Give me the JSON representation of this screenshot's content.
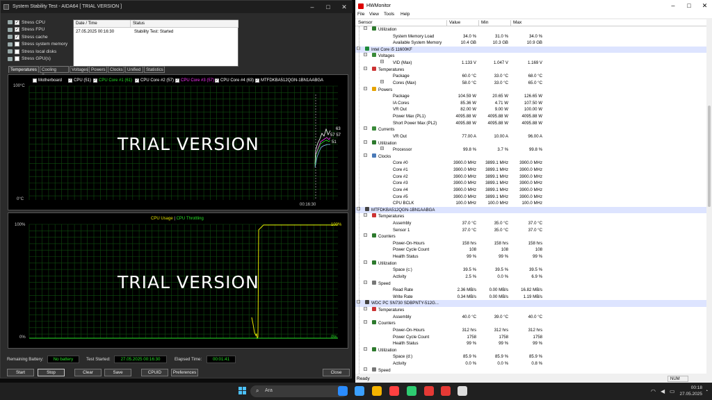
{
  "aida": {
    "title": "System Stability Test - AIDA64  [ TRIAL VERSION ]",
    "stress_items": [
      {
        "label": "Stress CPU",
        "checked": true
      },
      {
        "label": "Stress FPU",
        "checked": true
      },
      {
        "label": "Stress cache",
        "checked": true
      },
      {
        "label": "Stress system memory",
        "checked": false
      },
      {
        "label": "Stress local disks",
        "checked": false
      },
      {
        "label": "Stress GPU(s)",
        "checked": false
      }
    ],
    "status_table": {
      "col_datetime": "Date / Time",
      "col_status": "Status",
      "row_datetime": "27.05.2025 00:16:30",
      "row_status": "Stability Test: Started"
    },
    "tabs": [
      "Temperatures",
      "Cooling Fans",
      "Voltages",
      "Powers",
      "Clocks",
      "Unified",
      "Statistics"
    ],
    "legend": [
      {
        "label": "Motherboard",
        "color": "#ffffff"
      },
      {
        "label": "CPU (51)",
        "color": "#ffffff"
      },
      {
        "label": "CPU Core #1 (61)",
        "color": "#27e027"
      },
      {
        "label": "CPU Core #2 (57)",
        "color": "#ffffff"
      },
      {
        "label": "CPU Core #3 (57)",
        "color": "#ff33ff"
      },
      {
        "label": "CPU Core #4 (63)",
        "color": "#ffffff"
      },
      {
        "label": "MTFDKBA512QGN-1BN1AABGA",
        "color": "#ffffff"
      }
    ],
    "temp_graph": {
      "top_label": "100°C",
      "bottom_label": "0°C",
      "time_label": "00:16:30",
      "value_labels": [
        "63",
        "57 57",
        "51"
      ],
      "watermark": "TRIAL VERSION"
    },
    "cpu_graph": {
      "title_usage": "CPU Usage",
      "title_sep": "|",
      "title_throttle": "CPU Throttling",
      "top_left": "100%",
      "top_right": "100%",
      "bottom_left": "0%",
      "bottom_right": "0%",
      "watermark": "TRIAL VERSION"
    },
    "footer": {
      "remaining_battery_label": "Remaining Battery:",
      "remaining_battery_value": "No battery",
      "test_started_label": "Test Started:",
      "test_started_value": "27.05.2025 00:16:30",
      "elapsed_label": "Elapsed Time:",
      "elapsed_value": "00:01:41"
    },
    "buttons": {
      "start": "Start",
      "stop": "Stop",
      "clear": "Clear",
      "save": "Save",
      "cpuid": "CPUID",
      "preferences": "Preferences",
      "close": "Close"
    }
  },
  "hw": {
    "title": "HWMonitor",
    "menu": [
      "File",
      "View",
      "Tools",
      "Help"
    ],
    "columns": {
      "sensor": "Sensor",
      "value": "Value",
      "min": "Min",
      "max": "Max"
    },
    "rows": [
      {
        "lvl": 1,
        "icon": "util",
        "name": "Utilization"
      },
      {
        "lvl": 3,
        "name": "System Memory Load",
        "v": "34.0 %",
        "mn": "31.0 %",
        "mx": "34.0 %"
      },
      {
        "lvl": 3,
        "name": "Available System Memory",
        "v": "10.4 GB",
        "mn": "10.3 GB",
        "mx": "10.9 GB"
      },
      {
        "lvl": 0,
        "icon": "chip",
        "name": "Intel Core i5 11600KF"
      },
      {
        "lvl": 1,
        "icon": "volt",
        "name": "Voltages"
      },
      {
        "lvl": 2,
        "name": "VID (Max)",
        "v": "1.133 V",
        "mn": "1.047 V",
        "mx": "1.169 V",
        "exp": true
      },
      {
        "lvl": 1,
        "icon": "temp",
        "name": "Temperatures"
      },
      {
        "lvl": 3,
        "name": "Package",
        "v": "60.0 °C",
        "mn": "33.0 °C",
        "mx": "68.0 °C"
      },
      {
        "lvl": 2,
        "name": "Cores (Max)",
        "v": "58.0 °C",
        "mn": "33.0 °C",
        "mx": "65.0 °C",
        "exp": true
      },
      {
        "lvl": 1,
        "icon": "power",
        "name": "Powers"
      },
      {
        "lvl": 3,
        "name": "Package",
        "v": "104.59 W",
        "mn": "20.65 W",
        "mx": "126.65 W"
      },
      {
        "lvl": 3,
        "name": "IA Cores",
        "v": "85.36 W",
        "mn": "4.71 W",
        "mx": "107.50 W"
      },
      {
        "lvl": 3,
        "name": "VR Out",
        "v": "82.00 W",
        "mn": "9.00 W",
        "mx": "100.00 W"
      },
      {
        "lvl": 3,
        "name": "Power Max (PL1)",
        "v": "4095.88 W",
        "mn": "4095.88 W",
        "mx": "4095.88 W"
      },
      {
        "lvl": 3,
        "name": "Short Power Max (PL2)",
        "v": "4095.88 W",
        "mn": "4095.88 W",
        "mx": "4095.88 W"
      },
      {
        "lvl": 1,
        "icon": "volt",
        "name": "Currents"
      },
      {
        "lvl": 3,
        "name": "VR Out",
        "v": "77.00 A",
        "mn": "10.00 A",
        "mx": "96.00 A"
      },
      {
        "lvl": 1,
        "icon": "util",
        "name": "Utilization"
      },
      {
        "lvl": 2,
        "name": "Processor",
        "v": "99.8 %",
        "mn": "3.7 %",
        "mx": "99.8 %",
        "exp": true
      },
      {
        "lvl": 1,
        "icon": "clock",
        "name": "Clocks"
      },
      {
        "lvl": 3,
        "name": "Core #0",
        "v": "3900.0 MHz",
        "mn": "3899.1 MHz",
        "mx": "3900.0 MHz"
      },
      {
        "lvl": 3,
        "name": "Core #1",
        "v": "3900.0 MHz",
        "mn": "3899.1 MHz",
        "mx": "3900.0 MHz"
      },
      {
        "lvl": 3,
        "name": "Core #2",
        "v": "3900.0 MHz",
        "mn": "3899.1 MHz",
        "mx": "3900.0 MHz"
      },
      {
        "lvl": 3,
        "name": "Core #3",
        "v": "3900.0 MHz",
        "mn": "3899.1 MHz",
        "mx": "3900.0 MHz"
      },
      {
        "lvl": 3,
        "name": "Core #4",
        "v": "3900.0 MHz",
        "mn": "3899.1 MHz",
        "mx": "3900.0 MHz"
      },
      {
        "lvl": 3,
        "name": "Core #5",
        "v": "3900.0 MHz",
        "mn": "3899.1 MHz",
        "mx": "3900.0 MHz"
      },
      {
        "lvl": 3,
        "name": "CPU BCLK",
        "v": "100.0 MHz",
        "mn": "100.0 MHz",
        "mx": "100.0 MHz"
      },
      {
        "lvl": 0,
        "icon": "disk",
        "name": "MTFDKBA512QGN-1BN1AABGA"
      },
      {
        "lvl": 1,
        "icon": "temp",
        "name": "Temperatures"
      },
      {
        "lvl": 3,
        "name": "Assembly",
        "v": "37.0 °C",
        "mn": "35.0 °C",
        "mx": "37.0 °C"
      },
      {
        "lvl": 3,
        "name": "Sensor 1",
        "v": "37.0 °C",
        "mn": "35.0 °C",
        "mx": "37.0 °C"
      },
      {
        "lvl": 1,
        "icon": "util",
        "name": "Counters"
      },
      {
        "lvl": 3,
        "name": "Power-On-Hours",
        "v": "158 hrs",
        "mn": "158 hrs",
        "mx": "158 hrs"
      },
      {
        "lvl": 3,
        "name": "Power Cycle Count",
        "v": "108",
        "mn": "108",
        "mx": "108"
      },
      {
        "lvl": 3,
        "name": "Health Status",
        "v": "99 %",
        "mn": "99 %",
        "mx": "99 %"
      },
      {
        "lvl": 1,
        "icon": "util",
        "name": "Utilization"
      },
      {
        "lvl": 3,
        "name": "Space (c:)",
        "v": "39.5 %",
        "mn": "39.5 %",
        "mx": "39.5 %"
      },
      {
        "lvl": 3,
        "name": "Activity",
        "v": "2.5 %",
        "mn": "0.0 %",
        "mx": "6.9 %"
      },
      {
        "lvl": 1,
        "icon": "speed",
        "name": "Speed"
      },
      {
        "lvl": 3,
        "name": "Read Rate",
        "v": "2.36 MB/s",
        "mn": "0.00 MB/s",
        "mx": "16.82 MB/s"
      },
      {
        "lvl": 3,
        "name": "Write Rate",
        "v": "0.34 MB/s",
        "mn": "0.00 MB/s",
        "mx": "1.19 MB/s"
      },
      {
        "lvl": 0,
        "icon": "disk",
        "name": "WDC PC SN730 SDBPNTY-512G..."
      },
      {
        "lvl": 1,
        "icon": "temp",
        "name": "Temperatures"
      },
      {
        "lvl": 3,
        "name": "Assembly",
        "v": "40.0 °C",
        "mn": "39.0 °C",
        "mx": "40.0 °C"
      },
      {
        "lvl": 1,
        "icon": "util",
        "name": "Counters"
      },
      {
        "lvl": 3,
        "name": "Power-On-Hours",
        "v": "312 hrs",
        "mn": "312 hrs",
        "mx": "312 hrs"
      },
      {
        "lvl": 3,
        "name": "Power Cycle Count",
        "v": "1758",
        "mn": "1758",
        "mx": "1758"
      },
      {
        "lvl": 3,
        "name": "Health Status",
        "v": "99 %",
        "mn": "99 %",
        "mx": "99 %"
      },
      {
        "lvl": 1,
        "icon": "util",
        "name": "Utilization"
      },
      {
        "lvl": 3,
        "name": "Space (d:)",
        "v": "85.9 %",
        "mn": "85.9 %",
        "mx": "85.9 %"
      },
      {
        "lvl": 3,
        "name": "Activity",
        "v": "0.0 %",
        "mn": "0.0 %",
        "mx": "0.8 %"
      },
      {
        "lvl": 1,
        "icon": "speed",
        "name": "Speed"
      }
    ],
    "status": "Ready",
    "num": "NUM"
  },
  "taskbar": {
    "search_placeholder": "Ara",
    "time": "00:18",
    "date": "27.05.2025",
    "icon_colors": [
      "#2a8cff",
      "#3ba0ff",
      "#f4b400",
      "#ff4040",
      "#2ecc71",
      "#e53935",
      "#e53935",
      "#ddd"
    ]
  }
}
